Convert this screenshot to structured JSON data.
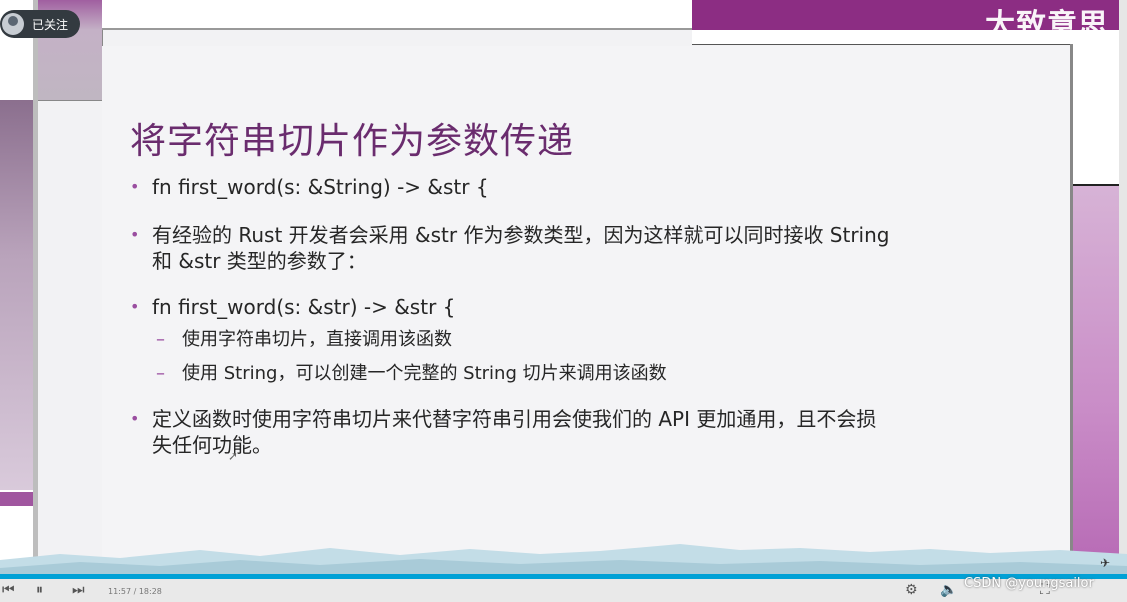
{
  "follow": {
    "label": "已关注"
  },
  "watermark": {
    "top": "大致意思",
    "sub": "",
    "csdn": "CSDN @youngsailor"
  },
  "slide": {
    "title": "将字符串切片作为参数传递",
    "bullets": [
      {
        "text": "fn first_word(s: &String) -> &str {"
      },
      {
        "text_line1": "有经验的 Rust 开发者会采用 &str 作为参数类型，因为这样就可以同时接收 String",
        "text_line2": "和 &str 类型的参数了："
      },
      {
        "text": "fn first_word(s: &str) -> &str {"
      },
      {
        "text_line1": "定义函数时使用字符串切片来代替字符串引用会使我们的 API 更加通用，且不会损",
        "text_line2": "失任何功能。"
      }
    ],
    "sub_bullets": [
      "使用字符串切片，直接调用该函数",
      "使用 String，可以创建一个完整的 String 切片来调用该函数"
    ],
    "bullet_glyph": "•",
    "sub_glyph": "–"
  },
  "player": {
    "progress": 1.0,
    "timecode": "11:57 / 18:28"
  },
  "colors": {
    "title": "#6a2c6e",
    "accent": "#9a4ea0",
    "progress": "#00a1d6",
    "top_band": "#8c2d83"
  },
  "icons": [
    "play-icon",
    "pause-icon",
    "next-icon",
    "settings-icon",
    "volume-icon",
    "fullscreen-icon"
  ]
}
